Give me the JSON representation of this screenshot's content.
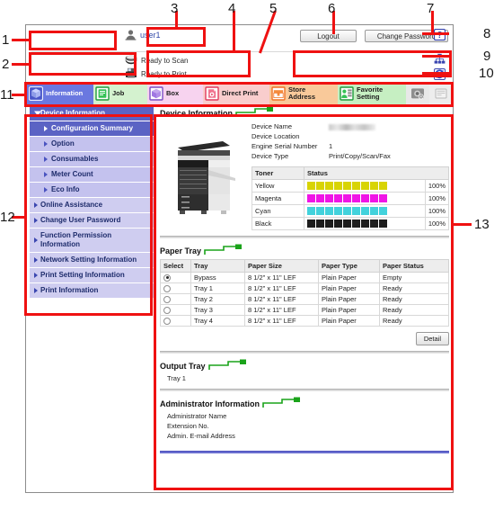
{
  "header": {
    "user_name": "user1",
    "user_icon": "user-icon",
    "logout_label": "Logout",
    "change_password_label": "Change Password",
    "status": [
      {
        "icon": "scanner-icon",
        "text": "Ready to Scan"
      },
      {
        "icon": "printer-icon",
        "text": "Ready to Print"
      }
    ],
    "help_icon": "help-question-icon",
    "network_icon": "network-tree-icon",
    "refresh_icon": "refresh-icon"
  },
  "tabs": [
    {
      "label": "Information",
      "icon": "information-cube-icon",
      "selected": true
    },
    {
      "label": "Job",
      "icon": "job-document-icon",
      "selected": false
    },
    {
      "label": "Box",
      "icon": "box-icon",
      "selected": false
    },
    {
      "label": "Direct Print",
      "icon": "direct-print-icon",
      "selected": false
    },
    {
      "label_line1": "Store",
      "label_line2": "Address",
      "icon": "store-address-icon",
      "selected": false
    },
    {
      "label_line1": "Favorite",
      "label_line2": "Setting",
      "icon": "favorite-setting-icon",
      "selected": false
    },
    {
      "label": "",
      "icon": "camera-settings-icon",
      "selected": false
    },
    {
      "label": "",
      "icon": "blank-panel-icon",
      "selected": false
    }
  ],
  "sidebar": {
    "items": [
      {
        "label": "Device Information",
        "level": 0,
        "expanded": true,
        "selected": false,
        "header": true
      },
      {
        "label": "Configuration Summary",
        "level": 1,
        "selected": true
      },
      {
        "label": "Option",
        "level": 1,
        "selected": false
      },
      {
        "label": "Consumables",
        "level": 1,
        "selected": false
      },
      {
        "label": "Meter Count",
        "level": 1,
        "selected": false
      },
      {
        "label": "Eco Info",
        "level": 1,
        "selected": false
      },
      {
        "label": "Online Assistance",
        "level": 0,
        "selected": false
      },
      {
        "label": "Change User Password",
        "level": 0,
        "selected": false
      },
      {
        "label": "Function Permission Information",
        "level": 0,
        "selected": false
      },
      {
        "label": "Network Setting Information",
        "level": 0,
        "selected": false
      },
      {
        "label": "Print Setting Information",
        "level": 0,
        "selected": false
      },
      {
        "label": "Print Information",
        "level": 0,
        "selected": false
      }
    ]
  },
  "main": {
    "device_information": {
      "title": "Device Information",
      "printer_icon": "multifunction-printer-image",
      "fields": [
        {
          "key": "Device Name",
          "value": "",
          "redacted": true
        },
        {
          "key": "Device Location",
          "value": ""
        },
        {
          "key": "Engine Serial Number",
          "value": "1"
        },
        {
          "key": "Device Type",
          "value": "Print/Copy/Scan/Fax"
        }
      ],
      "toner_table": {
        "headers": [
          "Toner",
          "Status"
        ],
        "rows": [
          {
            "name": "Yellow",
            "color": "#d8d404",
            "percent": "100%",
            "filled": 9,
            "total": 9
          },
          {
            "name": "Magenta",
            "color": "#f014e6",
            "percent": "100%",
            "filled": 9,
            "total": 9
          },
          {
            "name": "Cyan",
            "color": "#42d2dc",
            "percent": "100%",
            "filled": 9,
            "total": 9
          },
          {
            "name": "Black",
            "color": "#1d1d1d",
            "percent": "100%",
            "filled": 9,
            "total": 9
          }
        ]
      }
    },
    "paper_tray": {
      "title": "Paper Tray",
      "headers": [
        "Select",
        "Tray",
        "Paper Size",
        "Paper Type",
        "Paper Status"
      ],
      "rows": [
        {
          "selected": true,
          "tray": "Bypass",
          "size": "8 1/2\" x 11\" LEF",
          "type": "Plain Paper",
          "status": "Empty"
        },
        {
          "selected": false,
          "tray": "Tray 1",
          "size": "8 1/2\" x 11\" LEF",
          "type": "Plain Paper",
          "status": "Ready"
        },
        {
          "selected": false,
          "tray": "Tray 2",
          "size": "8 1/2\" x 11\" LEF",
          "type": "Plain Paper",
          "status": "Ready"
        },
        {
          "selected": false,
          "tray": "Tray 3",
          "size": "8 1/2\" x 11\" LEF",
          "type": "Plain Paper",
          "status": "Ready"
        },
        {
          "selected": false,
          "tray": "Tray 4",
          "size": "8 1/2\" x 11\" LEF",
          "type": "Plain Paper",
          "status": "Ready"
        }
      ],
      "detail_label": "Detail"
    },
    "output_tray": {
      "title": "Output Tray",
      "value": "Tray 1"
    },
    "administrator_information": {
      "title": "Administrator Information",
      "fields": [
        "Administrator Name",
        "Extension No.",
        "Admin. E-mail Address"
      ]
    }
  },
  "callouts": [
    {
      "number": "1"
    },
    {
      "number": "2"
    },
    {
      "number": "3"
    },
    {
      "number": "4"
    },
    {
      "number": "5"
    },
    {
      "number": "6"
    },
    {
      "number": "7"
    },
    {
      "number": "8"
    },
    {
      "number": "9"
    },
    {
      "number": "10"
    },
    {
      "number": "11"
    },
    {
      "number": "12"
    },
    {
      "number": "13"
    }
  ],
  "colors": {
    "callout_red": "#ef1111",
    "tab_selected": "#6a78e0",
    "sidebar_selected": "#5b63c4",
    "sidebar_bg": "#cfcdf0"
  }
}
